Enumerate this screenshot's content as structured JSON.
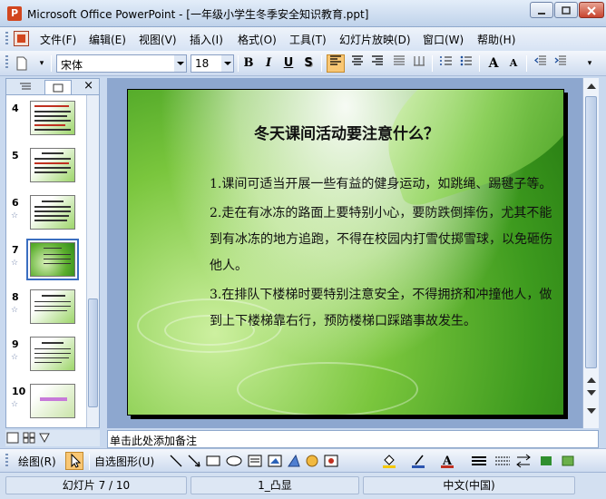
{
  "window": {
    "title": "Microsoft Office PowerPoint - [一年级小学生冬季安全知识教育.ppt]"
  },
  "menu": [
    "文件(F)",
    "编辑(E)",
    "视图(V)",
    "插入(I)",
    "格式(O)",
    "工具(T)",
    "幻灯片放映(D)",
    "窗口(W)",
    "帮助(H)"
  ],
  "formatting": {
    "font_name": "宋体",
    "font_size": "18",
    "bold": "B",
    "italic": "I",
    "underline": "U",
    "shadow": "S",
    "increase_font": "A",
    "decrease_font": "A"
  },
  "slides_panel": {
    "thumbnails": [
      {
        "number": "4",
        "star": ""
      },
      {
        "number": "5",
        "star": ""
      },
      {
        "number": "6",
        "star": "☆"
      },
      {
        "number": "7",
        "star": "☆"
      },
      {
        "number": "8",
        "star": "☆"
      },
      {
        "number": "9",
        "star": "☆"
      },
      {
        "number": "10",
        "star": "☆"
      }
    ],
    "selected": "7"
  },
  "slide": {
    "title": "冬天课间活动要注意什么？",
    "paragraphs": [
      "1.课间可适当开展一些有益的健身运动，如跳绳、踢毽子等。",
      "2.走在有冰冻的路面上要特别小心，要防跌倒摔伤，尤其不能到有冰冻的地方追跑，不得在校园内打雪仗掷雪球，以免砸伤他人。",
      "3.在排队下楼梯时要特别注意安全，不得拥挤和冲撞他人，做到上下楼梯靠右行，预防楼梯口踩踏事故发生。"
    ]
  },
  "notes": {
    "placeholder": "单击此处添加备注"
  },
  "drawing": {
    "draw_label": "绘图(R)",
    "autoshapes_label": "自选图形(U)"
  },
  "status": {
    "slide_info": "幻灯片 7 / 10",
    "design": "1_凸显",
    "language": "中文(中国)"
  }
}
